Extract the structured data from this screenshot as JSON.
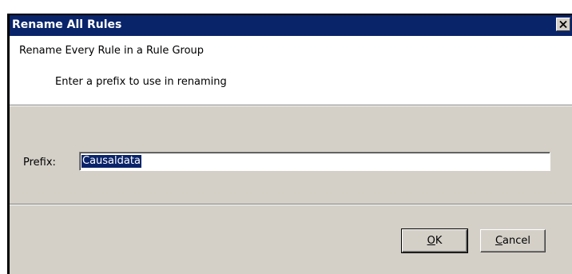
{
  "window": {
    "title": "Rename All Rules",
    "close_icon": "close-icon"
  },
  "header": {
    "title": "Rename Every Rule in a Rule Group",
    "subtitle": "Enter a prefix to use in renaming"
  },
  "form": {
    "prefix_label": "Prefix:",
    "prefix_value": "Causaldata"
  },
  "buttons": {
    "ok": {
      "accel": "O",
      "rest": "K"
    },
    "cancel": {
      "accel": "C",
      "rest": "ancel"
    }
  },
  "colors": {
    "titlebar": "#0a246a",
    "dialog_bg": "#d4d0c8",
    "selection": "#0a246a"
  }
}
